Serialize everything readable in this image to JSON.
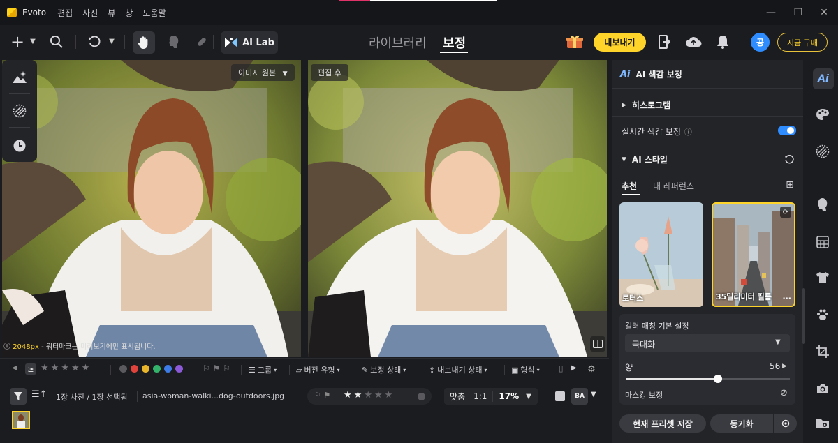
{
  "titlebar": {
    "app_name": "Evoto",
    "menu": [
      "편집",
      "사진",
      "뷰",
      "창",
      "도움말"
    ]
  },
  "toolbar": {
    "ai_lab_label": "AI Lab",
    "nav_library": "라이브러리",
    "nav_edit": "보정",
    "export_label": "내보내기",
    "avatar_initial": "공",
    "buy_label": "지금 구매"
  },
  "viewer": {
    "before_tag": "이미지 원본",
    "after_tag": "편집 후",
    "watermark_note_size": "2048px",
    "watermark_note": " - 워터마크는 미리보기에만 표시됩니다."
  },
  "filter_bar": {
    "ge_symbol": "≥",
    "group_label": "그룹",
    "version_label": "버전 유형",
    "edit_status_label": "보정 상태",
    "export_status_label": "내보내기 상태",
    "format_label": "형식",
    "color_labels": [
      "#5a5a5e",
      "#e0433b",
      "#e8b52b",
      "#34b36b",
      "#3d7be6",
      "#8c5ad8"
    ]
  },
  "info_bar": {
    "count_text": "1장 사진 / 1장 선택됨",
    "filename": "asia-woman-walki...dog-outdoors.jpg",
    "fit_label": "맞춤",
    "one_to_one": "1:1",
    "zoom": "17%",
    "ba_label": "BA",
    "rating_stars": 2
  },
  "panel": {
    "title": "AI 색감 보정",
    "histogram": "히스토그램",
    "realtime_label": "실시간 색감 보정",
    "ai_style": "AI 스타일",
    "tab_recommend": "추천",
    "tab_my_ref": "내 레퍼런스",
    "card1_label": "로터스",
    "card2_label": "35밀리미터 필름",
    "match_title": "컬러 매칭 기본 설정",
    "intensity_value": "극대화",
    "amount_label": "양",
    "amount_value": "56",
    "amount": 56,
    "masking_label": "마스킹 보정",
    "save_preset": "현재 프리셋 저장",
    "sync": "동기화"
  }
}
